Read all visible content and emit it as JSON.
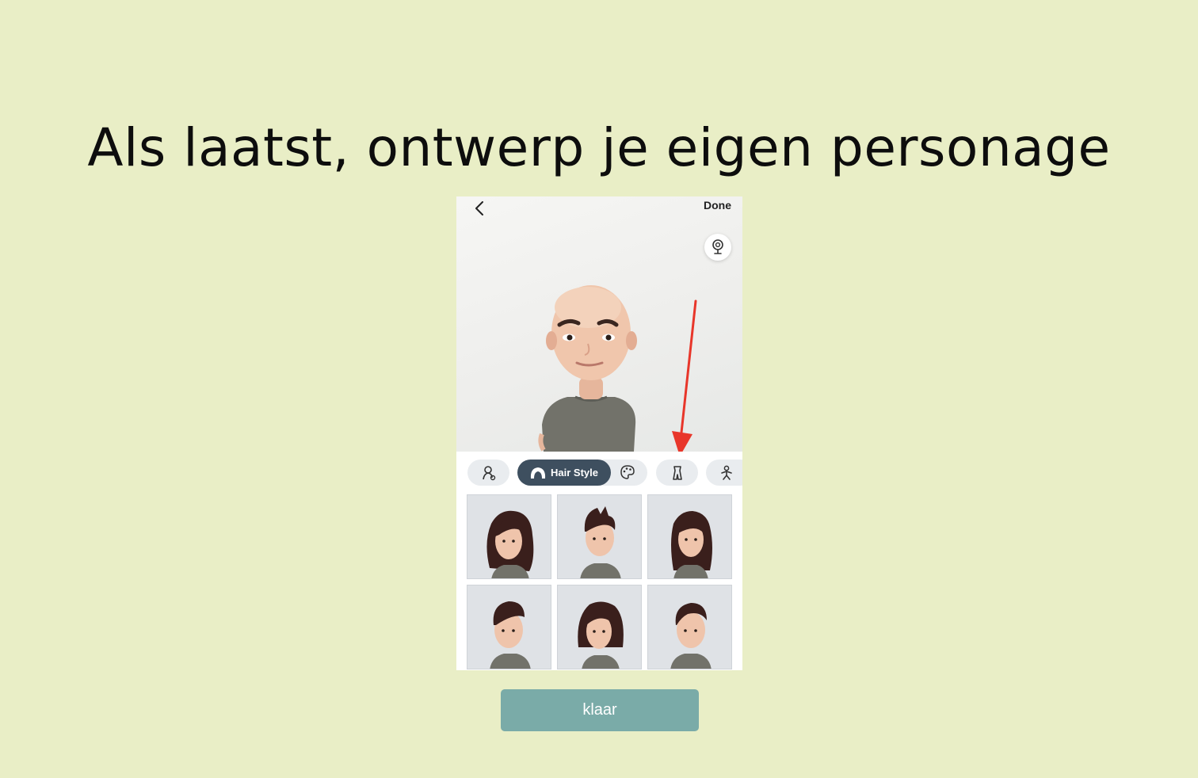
{
  "page": {
    "title": "Als laatst, ontwerp je eigen personage"
  },
  "editor": {
    "back_icon": "chevron-left-icon",
    "done_label": "Done",
    "mirror_icon": "mirror-icon",
    "tabs": [
      {
        "id": "body",
        "icon": "body-shape-icon"
      },
      {
        "id": "hair",
        "icon": "hair-icon",
        "label": "Hair Style",
        "active": true
      },
      {
        "id": "color",
        "icon": "palette-icon"
      },
      {
        "id": "outfit",
        "icon": "outfit-icon"
      },
      {
        "id": "pose",
        "icon": "pose-icon"
      }
    ],
    "hair_options": [
      {
        "style": "long-wavy"
      },
      {
        "style": "short-spiky"
      },
      {
        "style": "long-straight"
      },
      {
        "style": "short-quiff"
      },
      {
        "style": "bob"
      },
      {
        "style": "short-side"
      }
    ],
    "annotation_color": "#e8362a"
  },
  "cta": {
    "label": "klaar",
    "color": "#7aaba8"
  }
}
